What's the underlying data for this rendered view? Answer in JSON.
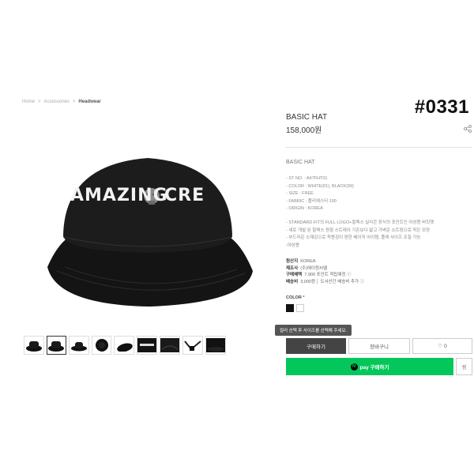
{
  "breadcrumb": {
    "home": "Home",
    "category": "Accessories",
    "current": "Headwear",
    "sep": ">"
  },
  "tag": "#0331",
  "product": {
    "title": "BASIC HAT",
    "price": "158,000원",
    "subtitle": "BASIC HAT",
    "hat_text_left": "AMAZING",
    "hat_text_right": "CRE",
    "specs": [
      "- ST NO. : A47FHT01",
      "- COLOR : WHITE(01), BLACK(99)",
      "- SIZE : FREE",
      "- FABRIC : 폴리에스터 100",
      "- ORIGIN : KOREA"
    ],
    "description": [
      "- STANDARD FIT의 FULL LOGO+할렉스 실리콘 장식의 포인트인 어성용 버킷햇",
      "- 새로 개발 된 할렉스 원형 스트레이 기존보다 얇고 가벼운 소트링으로 착은 모양",
      "- 부드러운 소재감으로 착용감이 편한 베이직 아이템, 플래 사이즈 조절 가능",
      "-여성용"
    ]
  },
  "meta": [
    {
      "label": "원산지",
      "value": "KOREA"
    },
    {
      "label": "제조사",
      "value": "(주)에이원씨엘"
    },
    {
      "label": "구매혜택",
      "value": "7,900 포인트 적립예정 ⓘ"
    },
    {
      "label": "배송비",
      "value": "3,000원 │ 도서산간 배송비 추가 ⓘ"
    }
  ],
  "color": {
    "label": "COLOR",
    "required_mark": "*",
    "swatches": [
      "#111111",
      "#ffffff"
    ]
  },
  "tooltip": "컬러 선택 후 사이즈를 선택해 주세요.",
  "buttons": {
    "buy": "구매하기",
    "cart": "장바구니",
    "like_count": "0",
    "npay": "pay 구매하기",
    "npay_logo": "N",
    "zzim": "찜"
  },
  "thumbnails": [
    "hat-front",
    "hat-front-selected",
    "hat-side",
    "hat-top",
    "hat-tilted",
    "hat-logo-closeup",
    "hat-underside",
    "hat-wearing",
    "hat-detail"
  ],
  "colors": {
    "npay_green": "#03c75a",
    "buy_dark": "#444444"
  }
}
